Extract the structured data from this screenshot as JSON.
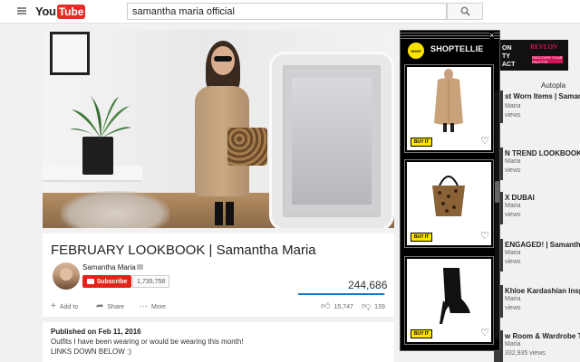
{
  "masthead": {
    "logo_you": "You",
    "logo_tube": "Tube",
    "search_value": "samantha maria official"
  },
  "video": {
    "title": "FEBRUARY LOOKBOOK | Samantha Maria",
    "channel": "Samantha Maria",
    "subscribe_label": "Subscribe",
    "subscriber_count": "1,735,758",
    "views": "244,686",
    "like_ratio": 0.99,
    "add_to_label": "Add to",
    "share_label": "Share",
    "more_label": "More",
    "likes": "15,747",
    "dislikes": "139"
  },
  "description": {
    "published": "Published on Feb 11, 2016",
    "line1": "Outfits I have been wearing or would be wearing this month!",
    "line2": "LINKS DOWN BELOW :)"
  },
  "ad": {
    "text_line1": "ON",
    "text_line2": "TY",
    "text_line3": "ACT",
    "brand": "REVLON",
    "cta": "DISCOVER YOUR PALETTE"
  },
  "sidebar": {
    "autoplay_label": "Autopla",
    "items": [
      {
        "title": "st Worn Items | Samantha",
        "channel": "Maria",
        "views": "views"
      },
      {
        "title": "N TREND LOOKBOOK | S",
        "channel": "Maria",
        "views": "views"
      },
      {
        "title": "X DUBAI",
        "channel": "Maria",
        "views": "views"
      },
      {
        "title": "ENGAGED! | Samantha M",
        "channel": "Maria",
        "views": "views"
      },
      {
        "title": "Khloe Kardashian Inspire",
        "channel": "Maria",
        "views": "views"
      },
      {
        "title": "w Room & Wardrobe Tou",
        "channel": "Maria",
        "views": "332,935 views"
      }
    ]
  },
  "shop": {
    "logo_text": "SHOP",
    "title": "SHOPTELLIE",
    "close": "×",
    "products": [
      {
        "name": "camel-coat",
        "buy_label": "BUY IT"
      },
      {
        "name": "leopard-tote",
        "buy_label": "BUY IT"
      },
      {
        "name": "black-ankle-boot",
        "buy_label": "BUY IT"
      }
    ]
  },
  "colors": {
    "brand_red": "#e62117",
    "shop_yellow": "#ffe400",
    "view_bar_blue": "#167ac6"
  }
}
